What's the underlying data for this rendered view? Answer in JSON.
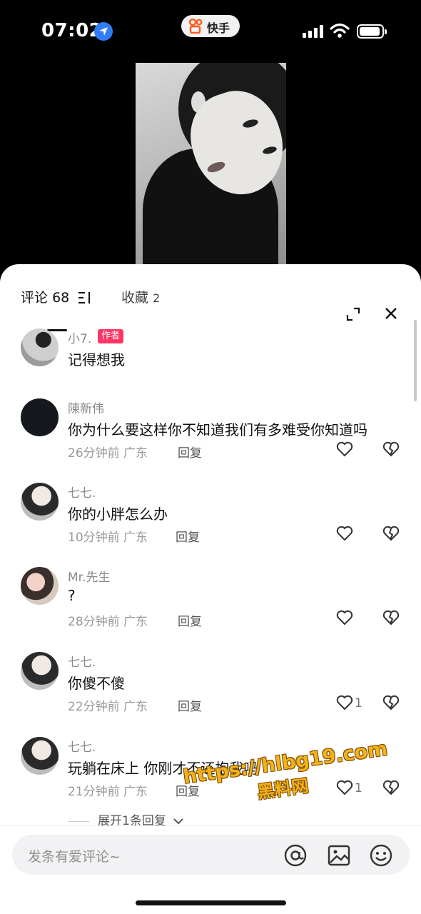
{
  "status_bar": {
    "time": "07:02",
    "app_label": "快手"
  },
  "tabs": {
    "comments_label": "评论",
    "comments_count": "68",
    "favorites_label": "收藏",
    "favorites_count": "2"
  },
  "comments": [
    {
      "username": "小7.",
      "badge": "作者",
      "text": "记得想我",
      "time": "",
      "reply_label": "",
      "likes": ""
    },
    {
      "username": "陳新伟",
      "text": "你为什么要这样你不知道我们有多难受你知道吗",
      "time": "26分钟前 广东",
      "reply_label": "回复",
      "likes": ""
    },
    {
      "username": "七七.",
      "text": "你的小胖怎么办",
      "time": "10分钟前 广东",
      "reply_label": "回复",
      "likes": ""
    },
    {
      "username": "Mr.先生",
      "text": "?",
      "time": "28分钟前 广东",
      "reply_label": "回复",
      "likes": ""
    },
    {
      "username": "七七.",
      "text": "你傻不傻",
      "time": "22分钟前 广东",
      "reply_label": "回复",
      "likes": "1"
    },
    {
      "username": "七七.",
      "text": "玩躺在床上 你刚才不还抱我吗",
      "time": "21分钟前 广东",
      "reply_label": "回复",
      "likes": "1"
    }
  ],
  "expand_replies_label": "展开1条回复",
  "watermark": {
    "url": "https://hlbg19.com",
    "site": "黑料网"
  },
  "input": {
    "placeholder": "发条有爱评论~"
  },
  "icons": [
    "location-icon",
    "wifi-icon",
    "battery-icon",
    "sort-icon",
    "expand-icon",
    "close-icon",
    "heart-icon",
    "dislike-icon",
    "at-icon",
    "image-icon",
    "emoji-icon"
  ],
  "colors": {
    "author_badge": "#fe3666",
    "location_blue": "#2f7df6"
  }
}
